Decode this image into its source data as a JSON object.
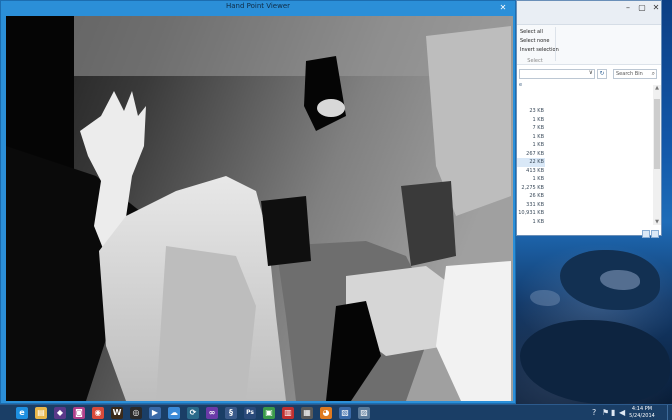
{
  "viewer": {
    "title": "Hand Point Viewer",
    "close_glyph": "✕"
  },
  "explorer": {
    "minimize_glyph": "–",
    "maximize_glyph": "▢",
    "close_glyph": "✕",
    "ribbon": {
      "select_all": "Select all",
      "select_none": "Select none",
      "invert_selection": "Invert selection",
      "group_label": "Select"
    },
    "address_chevron": "∨",
    "refresh_glyph": "↻",
    "search_placeholder": "Search Bin",
    "column_header": "e",
    "file_sizes": [
      "23 KB",
      "1 KB",
      "7 KB",
      "1 KB",
      "1 KB",
      "267 KB",
      "22 KB",
      "413 KB",
      "1 KB",
      "2,275 KB",
      "26 KB",
      "331 KB",
      "10,931 KB",
      "1 KB"
    ],
    "selected_row_index": 6
  },
  "taskbar": {
    "apps": [
      {
        "name": "internet-explorer-icon",
        "glyph": "e",
        "color": "#1e8fe0"
      },
      {
        "name": "file-explorer-icon",
        "glyph": "▤",
        "color": "#e8b64a"
      },
      {
        "name": "visual-app-icon",
        "glyph": "◆",
        "color": "#5a3a8a"
      },
      {
        "name": "chat-app-icon",
        "glyph": "◙",
        "color": "#b0408a"
      },
      {
        "name": "chrome-icon",
        "glyph": "◉",
        "color": "#d84a3a"
      },
      {
        "name": "warcraft-icon",
        "glyph": "W",
        "color": "#3a2a1a"
      },
      {
        "name": "steam-icon",
        "glyph": "◎",
        "color": "#2a2a2a"
      },
      {
        "name": "media-player-icon",
        "glyph": "▶",
        "color": "#3a6aa8"
      },
      {
        "name": "skydrive-icon",
        "glyph": "☁",
        "color": "#3a8ad8"
      },
      {
        "name": "sync-icon",
        "glyph": "⟳",
        "color": "#2a6a8a"
      },
      {
        "name": "visual-studio-icon",
        "glyph": "∞",
        "color": "#6a3aa8"
      },
      {
        "name": "python-icon",
        "glyph": "§",
        "color": "#3a5a8a"
      },
      {
        "name": "photoshop-icon",
        "glyph": "Ps",
        "color": "#2a4a7a"
      },
      {
        "name": "store-icon",
        "glyph": "▣",
        "color": "#3a9a4a"
      },
      {
        "name": "color-bars-icon",
        "glyph": "▥",
        "color": "#c03030"
      },
      {
        "name": "calibration-icon",
        "glyph": "▦",
        "color": "#5a5a5a"
      },
      {
        "name": "blender-icon",
        "glyph": "◕",
        "color": "#e07a20"
      },
      {
        "name": "project-icon",
        "glyph": "▧",
        "color": "#3a6aa8"
      },
      {
        "name": "viewer-app-icon",
        "glyph": "▨",
        "color": "#5a7a9a"
      }
    ],
    "tray": {
      "help_glyph": "?",
      "flag_glyph": "⚑",
      "network_glyph": "▮",
      "volume_glyph": "◀",
      "time": "4:14 PM",
      "date": "5/24/2014"
    }
  },
  "colors": {
    "accent": "#2b8fd8",
    "taskbar": "#1a3e66",
    "depth_background": "#000000"
  }
}
